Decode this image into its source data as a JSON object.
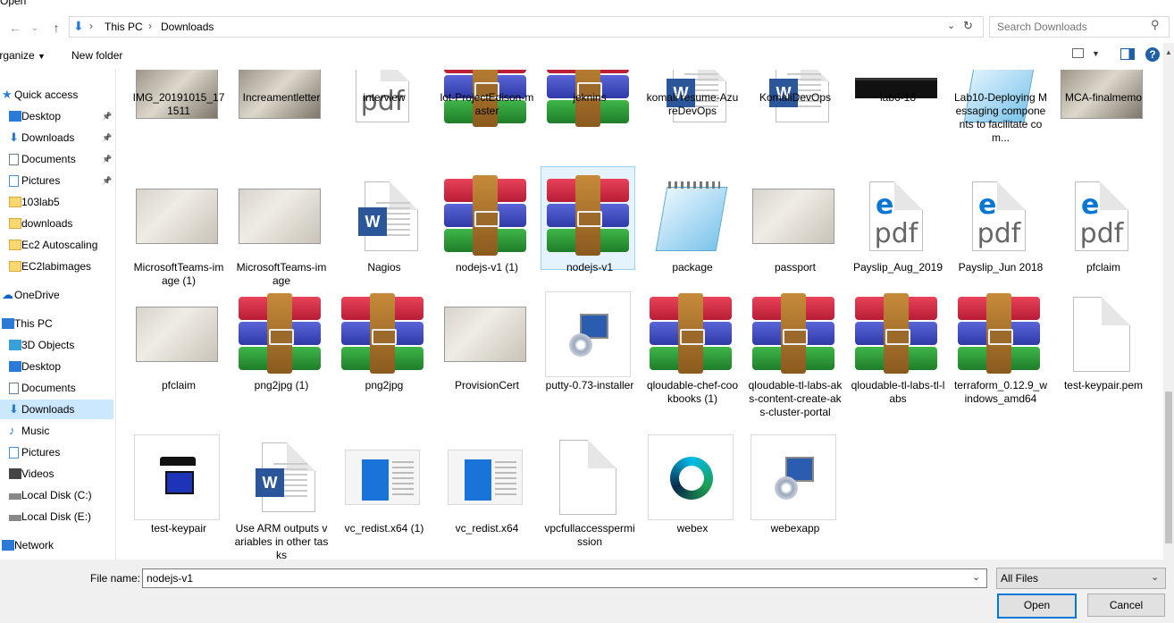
{
  "window": {
    "title": "Open"
  },
  "address": {
    "crumbs": [
      "This PC",
      "Downloads"
    ]
  },
  "search": {
    "placeholder": "Search Downloads"
  },
  "toolbar": {
    "organize": "Organize",
    "new_folder": "New folder"
  },
  "sidebar": {
    "items": [
      {
        "label": "Quick access",
        "icon": "star-icon",
        "pinned": false
      },
      {
        "label": "Desktop",
        "icon": "desktop-icon",
        "pinned": true
      },
      {
        "label": "Downloads",
        "icon": "download-arrow-icon",
        "pinned": true
      },
      {
        "label": "Documents",
        "icon": "documents-icon",
        "pinned": true
      },
      {
        "label": "Pictures",
        "icon": "pictures-icon",
        "pinned": true
      },
      {
        "label": "103lab5",
        "icon": "folder-icon",
        "pinned": false
      },
      {
        "label": "downloads",
        "icon": "folder-icon",
        "pinned": false
      },
      {
        "label": "Ec2 Autoscaling",
        "icon": "folder-icon",
        "pinned": false
      },
      {
        "label": "EC2labimages",
        "icon": "folder-icon",
        "pinned": false
      },
      {
        "label": "OneDrive",
        "icon": "cloud-icon",
        "pinned": false
      },
      {
        "label": "This PC",
        "icon": "computer-icon",
        "pinned": false
      },
      {
        "label": "3D Objects",
        "icon": "cube-icon",
        "pinned": false
      },
      {
        "label": "Desktop",
        "icon": "desktop-icon",
        "pinned": false
      },
      {
        "label": "Documents",
        "icon": "documents-icon",
        "pinned": false
      },
      {
        "label": "Downloads",
        "icon": "download-arrow-icon",
        "pinned": false,
        "selected": true
      },
      {
        "label": "Music",
        "icon": "music-icon",
        "pinned": false
      },
      {
        "label": "Pictures",
        "icon": "pictures-icon",
        "pinned": false
      },
      {
        "label": "Videos",
        "icon": "videos-icon",
        "pinned": false
      },
      {
        "label": "Local Disk (C:)",
        "icon": "disk-icon",
        "pinned": false
      },
      {
        "label": "Local Disk (E:)",
        "icon": "disk-icon",
        "pinned": false
      },
      {
        "label": "Network",
        "icon": "network-icon",
        "pinned": false
      }
    ]
  },
  "files": [
    {
      "name": "IMG_20191015_171511",
      "kind": "photo"
    },
    {
      "name": "Increamentletter",
      "kind": "photo"
    },
    {
      "name": "interview",
      "kind": "pdf"
    },
    {
      "name": "lot-ProjectEdison-master",
      "kind": "rar"
    },
    {
      "name": "jeknins",
      "kind": "rar"
    },
    {
      "name": "komali resume-AzureDevOps",
      "kind": "word"
    },
    {
      "name": "KomaliDevOps",
      "kind": "word"
    },
    {
      "name": "lab6-18",
      "kind": "screenshot"
    },
    {
      "name": "Lab10-Deploying Messaging components to facilitate com...",
      "kind": "notepad"
    },
    {
      "name": "MCA-finalmemo",
      "kind": "photo"
    },
    {
      "name": "MicrosoftTeams-image (1)",
      "kind": "photo"
    },
    {
      "name": "MicrosoftTeams-image",
      "kind": "photo"
    },
    {
      "name": "Nagios",
      "kind": "word"
    },
    {
      "name": "nodejs-v1 (1)",
      "kind": "rar"
    },
    {
      "name": "nodejs-v1",
      "kind": "rar",
      "selected": true
    },
    {
      "name": "package",
      "kind": "notepad"
    },
    {
      "name": "passport",
      "kind": "photo"
    },
    {
      "name": "Payslip_Aug_2019",
      "kind": "edgepdf"
    },
    {
      "name": "Payslip_Jun 2018",
      "kind": "edgepdf"
    },
    {
      "name": "pfclaim",
      "kind": "edgepdf"
    },
    {
      "name": "pfclaim",
      "kind": "photo"
    },
    {
      "name": "png2jpg (1)",
      "kind": "rar"
    },
    {
      "name": "png2jpg",
      "kind": "rar"
    },
    {
      "name": "ProvisionCert",
      "kind": "photo"
    },
    {
      "name": "putty-0.73-installer",
      "kind": "installer"
    },
    {
      "name": "qloudable-chef-cookbooks (1)",
      "kind": "rar"
    },
    {
      "name": "qloudable-tl-labs-aks-content-create-aks-cluster-portal",
      "kind": "rar"
    },
    {
      "name": "qloudable-tl-labs-tl-labs",
      "kind": "rar"
    },
    {
      "name": "terraform_0.12.9_windows_amd64",
      "kind": "rar"
    },
    {
      "name": "test-keypair.pem",
      "kind": "blank"
    },
    {
      "name": "test-keypair",
      "kind": "putty"
    },
    {
      "name": "Use ARM outputs variables in other tasks",
      "kind": "word"
    },
    {
      "name": "vc_redist.x64 (1)",
      "kind": "setup"
    },
    {
      "name": "vc_redist.x64",
      "kind": "setup"
    },
    {
      "name": "vpcfullaccesspermission",
      "kind": "blank"
    },
    {
      "name": "webex",
      "kind": "webex"
    },
    {
      "name": "webexapp",
      "kind": "installer"
    }
  ],
  "footer": {
    "file_name_label": "File name:",
    "file_name_value": "nodejs-v1",
    "file_type": "All Files",
    "open_label": "Open",
    "cancel_label": "Cancel"
  }
}
